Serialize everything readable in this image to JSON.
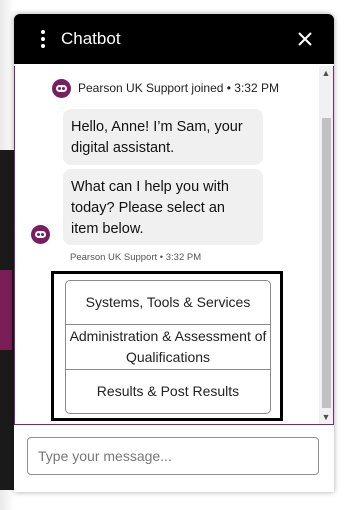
{
  "header": {
    "title": "Chatbot",
    "menu_icon": "more-vertical-icon",
    "close_icon": "close-icon"
  },
  "conversation": {
    "join_notice": "Pearson UK Support joined • 3:32 PM",
    "messages": [
      {
        "text": "Hello, Anne! I’m Sam, your digital assistant."
      },
      {
        "text": "What can I help you with today? Please select an item below."
      }
    ],
    "meta": "Pearson UK Support • 3:32 PM",
    "options": [
      {
        "label": "Systems, Tools & Services"
      },
      {
        "label": "Administration & Assessment of Qualifications"
      },
      {
        "label": "Results & Post Results"
      }
    ]
  },
  "composer": {
    "placeholder": "Type your message..."
  },
  "colors": {
    "header_bg": "#000000",
    "accent": "#7a1e62",
    "bubble_bg": "#f0f0f0"
  }
}
